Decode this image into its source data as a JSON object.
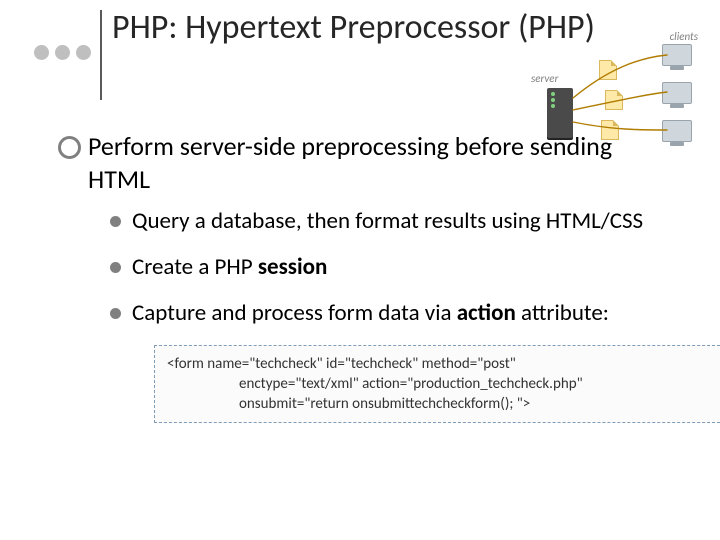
{
  "title": "PHP: Hypertext Preprocessor (PHP)",
  "diagram": {
    "server_label": "server",
    "clients_label": "clients"
  },
  "main_bullet": "Perform server-side preprocessing before sending HTML",
  "sub": [
    {
      "text": "Query a database, then format results using HTML/CSS"
    },
    {
      "prefix": "Create a PHP ",
      "bold": "session"
    },
    {
      "prefix": "Capture and process form data via ",
      "bold": "action",
      "suffix": " attribute:"
    }
  ],
  "code": {
    "line1": "<form name=\"techcheck\" id=\"techcheck\" method=\"post\"",
    "line2": "enctype=\"text/xml\" action=\"production_techcheck.php\"",
    "line3": "onsubmit=\"return onsubmittechcheckform(); \">"
  }
}
